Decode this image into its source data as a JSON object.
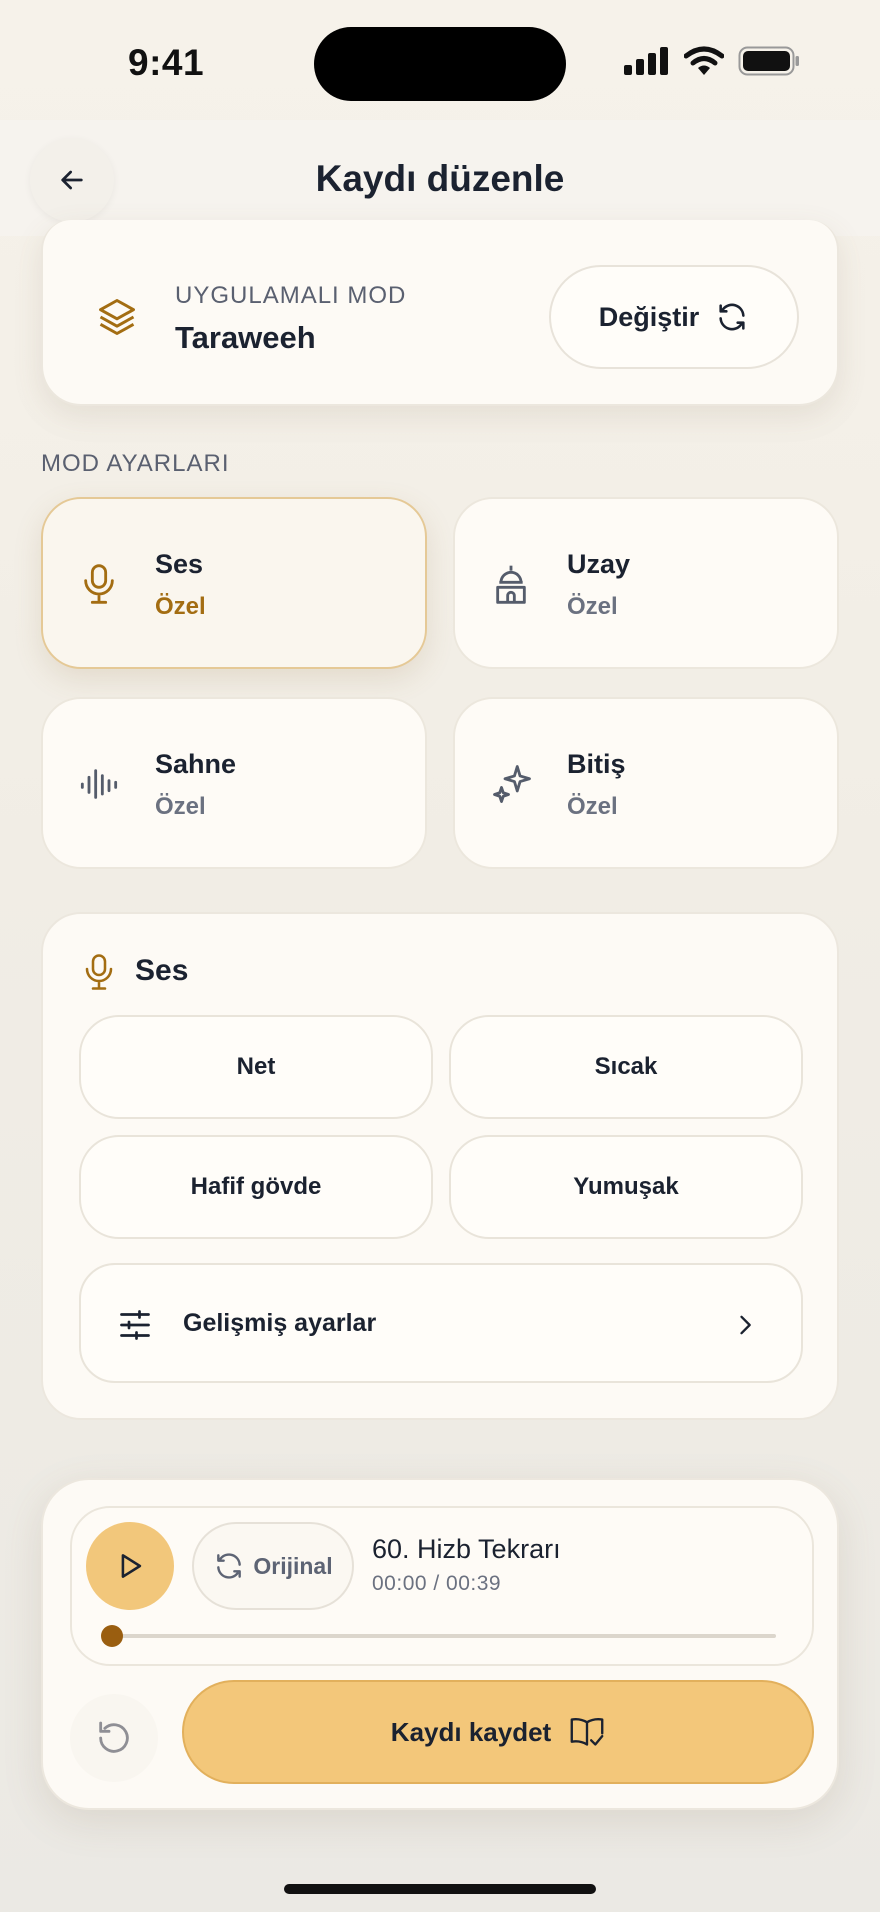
{
  "status_bar": {
    "time": "9:41"
  },
  "header": {
    "title": "Kaydı düzenle"
  },
  "mode": {
    "label": "UYGULAMALI MOD",
    "value": "Taraweeh",
    "change_label": "Değiştir"
  },
  "mode_settings": {
    "section_label": "MOD AYARLARI",
    "tiles": [
      {
        "title": "Ses",
        "subtitle": "Özel",
        "icon": "microphone-icon",
        "active": true
      },
      {
        "title": "Uzay",
        "subtitle": "Özel",
        "icon": "mosque-icon",
        "active": false
      },
      {
        "title": "Sahne",
        "subtitle": "Özel",
        "icon": "waveform-icon",
        "active": false
      },
      {
        "title": "Bitiş",
        "subtitle": "Özel",
        "icon": "sparkle-icon",
        "active": false
      }
    ]
  },
  "sound_panel": {
    "title": "Ses",
    "options": [
      "Net",
      "Sıcak",
      "Hafif gövde",
      "Yumuşak"
    ],
    "advanced_label": "Gelişmiş ayarlar"
  },
  "player": {
    "original_label": "Orijinal",
    "track_title": "60. Hizb Tekrarı",
    "time_display": "00:00 / 00:39",
    "progress": 0,
    "save_label": "Kaydı kaydet"
  },
  "colors": {
    "accent": "#f3c77a",
    "accent_dark": "#9a5e10",
    "icon_gold": "#a36d12",
    "text": "#1b2230",
    "muted": "#6b7180"
  }
}
